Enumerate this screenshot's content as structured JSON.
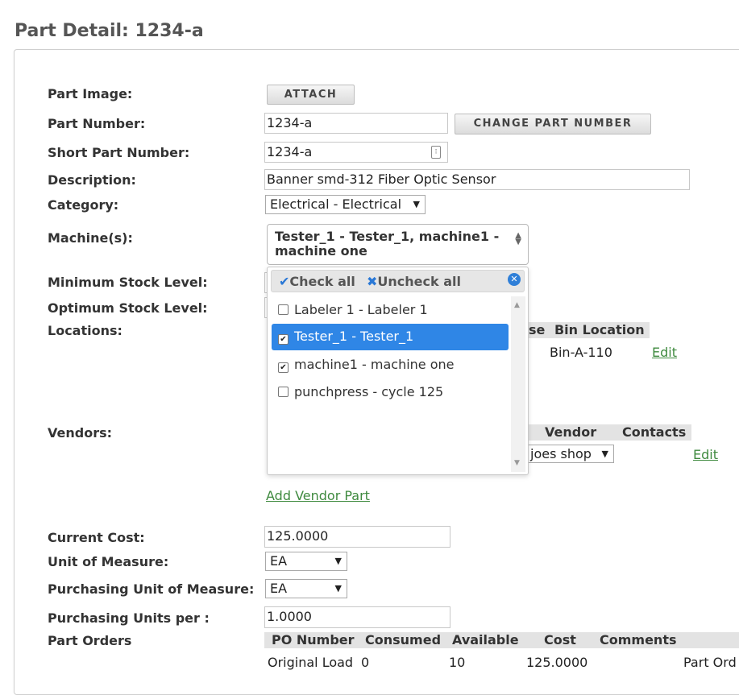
{
  "page": {
    "title": "Part Detail: 1234-a"
  },
  "form": {
    "part_image_label": "Part Image:",
    "attach_label": "ATTACH",
    "part_number_label": "Part Number:",
    "part_number_value": "1234-a",
    "change_part_number_label": "CHANGE PART NUMBER",
    "short_part_number_label": "Short Part Number:",
    "short_part_number_value": "1234-a",
    "description_label": "Description:",
    "description_value": "Banner smd-312 Fiber Optic Sensor",
    "category_label": "Category:",
    "category_value": "Electrical - Electrical",
    "machines_label": "Machine(s):",
    "machines_value": "Tester_1 - Tester_1, machine1 - machine one",
    "min_stock_label": "Minimum Stock Level:",
    "opt_stock_label": "Optimum Stock Level:",
    "locations_label": "Locations:",
    "vendors_label": "Vendors:",
    "current_cost_label": "Current Cost:",
    "current_cost_value": "125.0000",
    "uom_label": "Unit of Measure:",
    "uom_value": "EA",
    "puom_label": "Purchasing Unit of Measure:",
    "puom_value": "EA",
    "pu_per_label": "Purchasing Units per :",
    "pu_per_value": "1.0000",
    "part_orders_label": "Part Orders"
  },
  "machines_menu": {
    "check_all": "Check all",
    "uncheck_all": "Uncheck all",
    "items": [
      {
        "label": "Labeler 1 - Labeler 1",
        "checked": false
      },
      {
        "label": "Tester_1 - Tester_1",
        "checked": true
      },
      {
        "label": "machine1 - machine one",
        "checked": true
      },
      {
        "label": "punchpress - cycle 125",
        "checked": false
      }
    ]
  },
  "locations_table": {
    "headers": [
      "se",
      "Bin Location"
    ],
    "row": {
      "bin": "Bin-A-110",
      "edit": "Edit"
    }
  },
  "vendors_table": {
    "headers": [
      "Vendor",
      "Contacts"
    ],
    "row": {
      "vendor": "joes shop",
      "edit": "Edit"
    },
    "add_link": "Add Vendor Part"
  },
  "orders_table": {
    "headers": [
      "PO Number",
      "Consumed",
      "Available",
      "Cost",
      "Comments"
    ],
    "row": {
      "po": "Original Load",
      "consumed": "0",
      "available": "10",
      "cost": "125.0000",
      "comments": "Part Ord"
    }
  },
  "colors": {
    "accent": "#2f86e6",
    "link": "#3f8a3f"
  }
}
